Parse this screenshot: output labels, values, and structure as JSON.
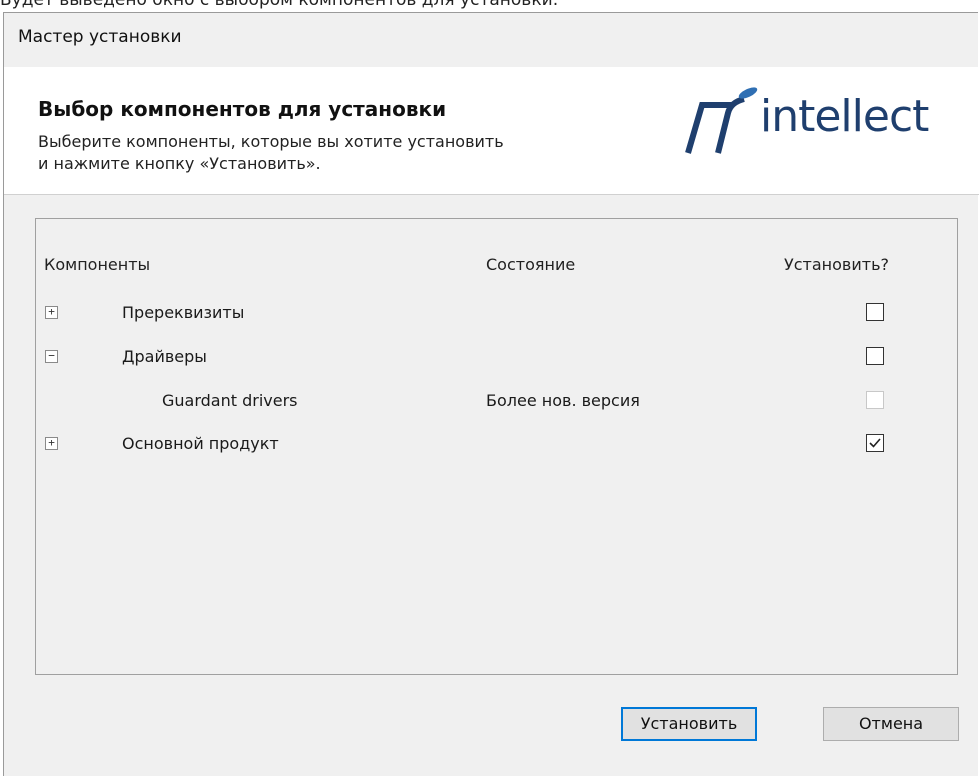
{
  "caption_above": "Будет выведено окно с выбором компонентов для установки:",
  "window": {
    "title": "Мастер установки"
  },
  "header": {
    "title": "Выбор компонентов для установки",
    "desc_line1": "Выберите компоненты, которые вы хотите установить",
    "desc_line2": "и нажмите кнопку «Установить».",
    "logo_text": "intellect",
    "logo_color": "#1f3f6e"
  },
  "table": {
    "col_components": "Компоненты",
    "col_state": "Состояние",
    "col_install": "Установить?",
    "rows": [
      {
        "label": "Пререквизиты",
        "expander": "+",
        "state": "",
        "checked": false
      },
      {
        "label": "Драйверы",
        "expander": "−",
        "state": "",
        "checked": false
      },
      {
        "label": "Guardant drivers",
        "expander": "",
        "state": "Более нов. версия",
        "checked": false
      },
      {
        "label": "Основной продукт",
        "expander": "+",
        "state": "",
        "checked": true
      }
    ]
  },
  "buttons": {
    "install": "Установить",
    "cancel": "Отмена"
  }
}
